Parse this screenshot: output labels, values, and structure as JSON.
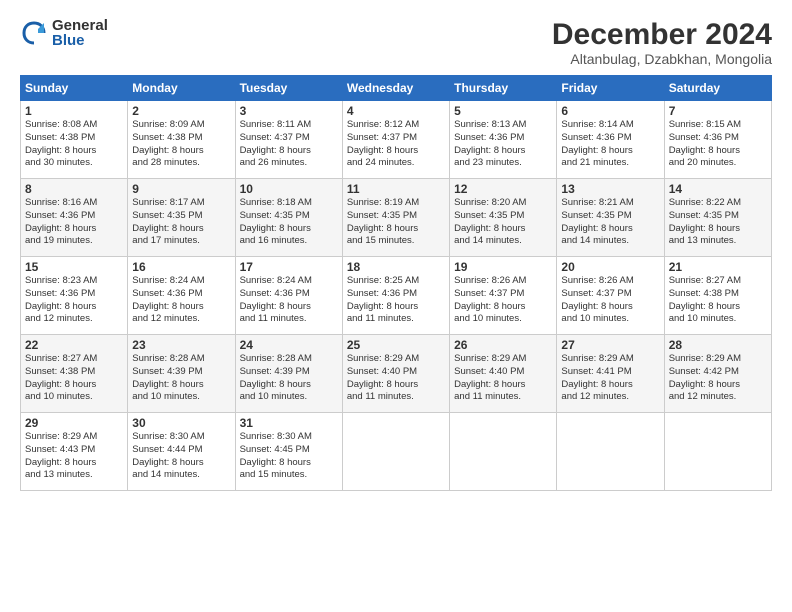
{
  "header": {
    "logo_general": "General",
    "logo_blue": "Blue",
    "title": "December 2024",
    "subtitle": "Altanbulag, Dzabkhan, Mongolia"
  },
  "columns": [
    "Sunday",
    "Monday",
    "Tuesday",
    "Wednesday",
    "Thursday",
    "Friday",
    "Saturday"
  ],
  "weeks": [
    [
      {
        "day": "1",
        "info": "Sunrise: 8:08 AM\nSunset: 4:38 PM\nDaylight: 8 hours\nand 30 minutes."
      },
      {
        "day": "2",
        "info": "Sunrise: 8:09 AM\nSunset: 4:38 PM\nDaylight: 8 hours\nand 28 minutes."
      },
      {
        "day": "3",
        "info": "Sunrise: 8:11 AM\nSunset: 4:37 PM\nDaylight: 8 hours\nand 26 minutes."
      },
      {
        "day": "4",
        "info": "Sunrise: 8:12 AM\nSunset: 4:37 PM\nDaylight: 8 hours\nand 24 minutes."
      },
      {
        "day": "5",
        "info": "Sunrise: 8:13 AM\nSunset: 4:36 PM\nDaylight: 8 hours\nand 23 minutes."
      },
      {
        "day": "6",
        "info": "Sunrise: 8:14 AM\nSunset: 4:36 PM\nDaylight: 8 hours\nand 21 minutes."
      },
      {
        "day": "7",
        "info": "Sunrise: 8:15 AM\nSunset: 4:36 PM\nDaylight: 8 hours\nand 20 minutes."
      }
    ],
    [
      {
        "day": "8",
        "info": "Sunrise: 8:16 AM\nSunset: 4:36 PM\nDaylight: 8 hours\nand 19 minutes."
      },
      {
        "day": "9",
        "info": "Sunrise: 8:17 AM\nSunset: 4:35 PM\nDaylight: 8 hours\nand 17 minutes."
      },
      {
        "day": "10",
        "info": "Sunrise: 8:18 AM\nSunset: 4:35 PM\nDaylight: 8 hours\nand 16 minutes."
      },
      {
        "day": "11",
        "info": "Sunrise: 8:19 AM\nSunset: 4:35 PM\nDaylight: 8 hours\nand 15 minutes."
      },
      {
        "day": "12",
        "info": "Sunrise: 8:20 AM\nSunset: 4:35 PM\nDaylight: 8 hours\nand 14 minutes."
      },
      {
        "day": "13",
        "info": "Sunrise: 8:21 AM\nSunset: 4:35 PM\nDaylight: 8 hours\nand 14 minutes."
      },
      {
        "day": "14",
        "info": "Sunrise: 8:22 AM\nSunset: 4:35 PM\nDaylight: 8 hours\nand 13 minutes."
      }
    ],
    [
      {
        "day": "15",
        "info": "Sunrise: 8:23 AM\nSunset: 4:36 PM\nDaylight: 8 hours\nand 12 minutes."
      },
      {
        "day": "16",
        "info": "Sunrise: 8:24 AM\nSunset: 4:36 PM\nDaylight: 8 hours\nand 12 minutes."
      },
      {
        "day": "17",
        "info": "Sunrise: 8:24 AM\nSunset: 4:36 PM\nDaylight: 8 hours\nand 11 minutes."
      },
      {
        "day": "18",
        "info": "Sunrise: 8:25 AM\nSunset: 4:36 PM\nDaylight: 8 hours\nand 11 minutes."
      },
      {
        "day": "19",
        "info": "Sunrise: 8:26 AM\nSunset: 4:37 PM\nDaylight: 8 hours\nand 10 minutes."
      },
      {
        "day": "20",
        "info": "Sunrise: 8:26 AM\nSunset: 4:37 PM\nDaylight: 8 hours\nand 10 minutes."
      },
      {
        "day": "21",
        "info": "Sunrise: 8:27 AM\nSunset: 4:38 PM\nDaylight: 8 hours\nand 10 minutes."
      }
    ],
    [
      {
        "day": "22",
        "info": "Sunrise: 8:27 AM\nSunset: 4:38 PM\nDaylight: 8 hours\nand 10 minutes."
      },
      {
        "day": "23",
        "info": "Sunrise: 8:28 AM\nSunset: 4:39 PM\nDaylight: 8 hours\nand 10 minutes."
      },
      {
        "day": "24",
        "info": "Sunrise: 8:28 AM\nSunset: 4:39 PM\nDaylight: 8 hours\nand 10 minutes."
      },
      {
        "day": "25",
        "info": "Sunrise: 8:29 AM\nSunset: 4:40 PM\nDaylight: 8 hours\nand 11 minutes."
      },
      {
        "day": "26",
        "info": "Sunrise: 8:29 AM\nSunset: 4:40 PM\nDaylight: 8 hours\nand 11 minutes."
      },
      {
        "day": "27",
        "info": "Sunrise: 8:29 AM\nSunset: 4:41 PM\nDaylight: 8 hours\nand 12 minutes."
      },
      {
        "day": "28",
        "info": "Sunrise: 8:29 AM\nSunset: 4:42 PM\nDaylight: 8 hours\nand 12 minutes."
      }
    ],
    [
      {
        "day": "29",
        "info": "Sunrise: 8:29 AM\nSunset: 4:43 PM\nDaylight: 8 hours\nand 13 minutes."
      },
      {
        "day": "30",
        "info": "Sunrise: 8:30 AM\nSunset: 4:44 PM\nDaylight: 8 hours\nand 14 minutes."
      },
      {
        "day": "31",
        "info": "Sunrise: 8:30 AM\nSunset: 4:45 PM\nDaylight: 8 hours\nand 15 minutes."
      },
      {
        "day": "",
        "info": ""
      },
      {
        "day": "",
        "info": ""
      },
      {
        "day": "",
        "info": ""
      },
      {
        "day": "",
        "info": ""
      }
    ]
  ]
}
